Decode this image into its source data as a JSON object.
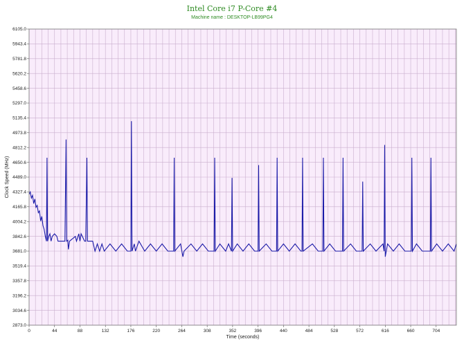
{
  "chart_data": {
    "type": "line",
    "title": "Intel Core i7 P-Core #4",
    "subtitle": "Machine name : DESKTOP-LB99PG4",
    "xlabel": "Time (seconds)",
    "ylabel": "Clock Speed (MHz)",
    "xlim": [
      0,
      739
    ],
    "ylim": [
      2873.0,
      6105.0
    ],
    "x_ticks": [
      0,
      44,
      88,
      132,
      176,
      220,
      264,
      308,
      352,
      396,
      440,
      484,
      528,
      572,
      616,
      660,
      704
    ],
    "y_ticks": [
      2873.0,
      3034.6,
      3196.2,
      3357.8,
      3519.4,
      3681.0,
      3842.6,
      4004.2,
      4165.8,
      4327.4,
      4489.0,
      4650.6,
      4812.2,
      4973.8,
      5135.4,
      5297.0,
      5458.6,
      5620.2,
      5781.8,
      5943.4,
      6105.0
    ],
    "grid": true,
    "colors": {
      "plot_bg": "#f9ecfb",
      "grid": "#c9aecd",
      "line": "#1a1aa8",
      "title": "#2e8b22"
    },
    "series": [
      {
        "values": [
          [
            0,
            4300
          ],
          [
            2,
            4327
          ],
          [
            4,
            4260
          ],
          [
            6,
            4290
          ],
          [
            8,
            4200
          ],
          [
            10,
            4250
          ],
          [
            12,
            4160
          ],
          [
            14,
            4180
          ],
          [
            16,
            4100
          ],
          [
            18,
            4120
          ],
          [
            20,
            4010
          ],
          [
            22,
            4060
          ],
          [
            24,
            3960
          ],
          [
            26,
            3920
          ],
          [
            28,
            3845
          ],
          [
            30,
            3790
          ],
          [
            31,
            4700
          ],
          [
            32,
            3790
          ],
          [
            34,
            3842
          ],
          [
            36,
            3870
          ],
          [
            38,
            3790
          ],
          [
            40,
            3842
          ],
          [
            44,
            3870
          ],
          [
            48,
            3842
          ],
          [
            50,
            3790
          ],
          [
            62,
            3790
          ],
          [
            64,
            4900
          ],
          [
            65,
            3790
          ],
          [
            67,
            3800
          ],
          [
            68,
            3700
          ],
          [
            70,
            3790
          ],
          [
            80,
            3842
          ],
          [
            82,
            3790
          ],
          [
            86,
            3870
          ],
          [
            88,
            3790
          ],
          [
            90,
            3870
          ],
          [
            96,
            3790
          ],
          [
            98,
            3790
          ],
          [
            100,
            4700
          ],
          [
            101,
            3790
          ],
          [
            110,
            3790
          ],
          [
            114,
            3681
          ],
          [
            118,
            3760
          ],
          [
            122,
            3681
          ],
          [
            126,
            3760
          ],
          [
            130,
            3681
          ],
          [
            140,
            3760
          ],
          [
            150,
            3681
          ],
          [
            160,
            3760
          ],
          [
            170,
            3681
          ],
          [
            176,
            3681
          ],
          [
            177,
            5100
          ],
          [
            178,
            3681
          ],
          [
            182,
            3760
          ],
          [
            184,
            3681
          ],
          [
            190,
            3790
          ],
          [
            200,
            3681
          ],
          [
            210,
            3760
          ],
          [
            220,
            3681
          ],
          [
            230,
            3760
          ],
          [
            240,
            3681
          ],
          [
            250,
            3681
          ],
          [
            251,
            4700
          ],
          [
            252,
            3681
          ],
          [
            262,
            3760
          ],
          [
            266,
            3620
          ],
          [
            268,
            3681
          ],
          [
            280,
            3760
          ],
          [
            290,
            3681
          ],
          [
            300,
            3760
          ],
          [
            310,
            3681
          ],
          [
            320,
            3681
          ],
          [
            321,
            4700
          ],
          [
            322,
            3681
          ],
          [
            330,
            3760
          ],
          [
            340,
            3681
          ],
          [
            345,
            3760
          ],
          [
            350,
            3681
          ],
          [
            351,
            4480
          ],
          [
            352,
            3681
          ],
          [
            360,
            3760
          ],
          [
            370,
            3681
          ],
          [
            380,
            3760
          ],
          [
            390,
            3681
          ],
          [
            396,
            3681
          ],
          [
            397,
            4620
          ],
          [
            398,
            3681
          ],
          [
            410,
            3760
          ],
          [
            420,
            3681
          ],
          [
            428,
            3681
          ],
          [
            429,
            4700
          ],
          [
            430,
            3681
          ],
          [
            440,
            3760
          ],
          [
            450,
            3681
          ],
          [
            460,
            3760
          ],
          [
            470,
            3681
          ],
          [
            472,
            3681
          ],
          [
            473,
            4700
          ],
          [
            474,
            3681
          ],
          [
            490,
            3760
          ],
          [
            500,
            3681
          ],
          [
            508,
            3681
          ],
          [
            509,
            4700
          ],
          [
            510,
            3681
          ],
          [
            520,
            3760
          ],
          [
            530,
            3681
          ],
          [
            542,
            3681
          ],
          [
            543,
            4700
          ],
          [
            544,
            3681
          ],
          [
            556,
            3760
          ],
          [
            566,
            3681
          ],
          [
            576,
            3681
          ],
          [
            577,
            4440
          ],
          [
            578,
            3681
          ],
          [
            590,
            3760
          ],
          [
            600,
            3681
          ],
          [
            612,
            3760
          ],
          [
            614,
            3681
          ],
          [
            615,
            4840
          ],
          [
            616,
            3620
          ],
          [
            620,
            3760
          ],
          [
            630,
            3681
          ],
          [
            640,
            3760
          ],
          [
            650,
            3681
          ],
          [
            661,
            3681
          ],
          [
            662,
            4700
          ],
          [
            663,
            3681
          ],
          [
            670,
            3760
          ],
          [
            680,
            3681
          ],
          [
            694,
            3681
          ],
          [
            695,
            4700
          ],
          [
            696,
            3681
          ],
          [
            705,
            3760
          ],
          [
            715,
            3681
          ],
          [
            725,
            3760
          ],
          [
            735,
            3681
          ],
          [
            739,
            3760
          ]
        ]
      }
    ]
  }
}
